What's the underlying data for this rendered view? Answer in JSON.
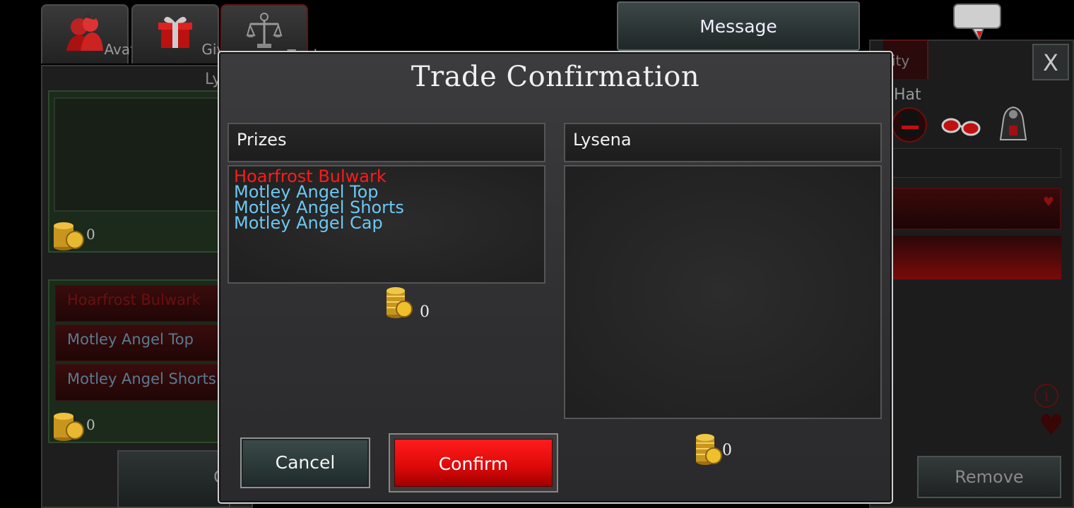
{
  "background": {
    "tabs": [
      {
        "label": "Avatar"
      },
      {
        "label": "Give"
      },
      {
        "label": "Trade"
      }
    ],
    "left_header_partial": "Ly",
    "left_coin_amount_top": "0",
    "left_items": [
      "Hoarfrost Bulwark",
      "Motley Angel Top",
      "Motley Angel Shorts"
    ],
    "left_coin_amount_bottom": "0",
    "left_button_partial": "C",
    "message_button": "Message",
    "right_tab_partial": "ity",
    "right_category_partial": "Hat",
    "close_label": "X",
    "remove_button": "Remove"
  },
  "dialog": {
    "title": "Trade Confirmation",
    "left_column": {
      "header": "Prizes",
      "items": [
        {
          "name": "Hoarfrost Bulwark",
          "color": "#ff1a1a"
        },
        {
          "name": "Motley Angel Top",
          "color": "#6cc8f4"
        },
        {
          "name": "Motley Angel Shorts",
          "color": "#6cc8f4"
        },
        {
          "name": "Motley Angel Cap",
          "color": "#6cc8f4"
        }
      ],
      "coins": "0"
    },
    "right_column": {
      "header": "Lysena",
      "items": [],
      "coins": "0"
    },
    "cancel_button": "Cancel",
    "confirm_button": "Confirm"
  }
}
